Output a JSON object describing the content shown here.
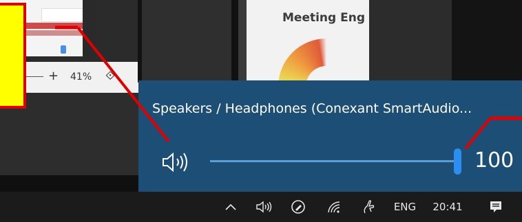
{
  "background": {
    "zoom_level": "41%",
    "zoom_plus_label": "+",
    "thumbnail_title": "Meeting Eng"
  },
  "volume_flyout": {
    "device_name": "Speakers / Headphones (Conexant SmartAudio...",
    "volume_value": "100",
    "volume_fraction": 1.0,
    "accent_color": "#2a8ff0",
    "background_color": "#1d4f76"
  },
  "taskbar": {
    "language": "ENG",
    "time": "20:41",
    "icons": [
      "chevron-up-icon",
      "speaker-icon",
      "pen-workspace-icon",
      "wifi-icon",
      "touch-keyboard-icon",
      "notifications-icon"
    ]
  },
  "annotation": {
    "callout_color": "#ffff00",
    "line_color": "#e00000"
  }
}
